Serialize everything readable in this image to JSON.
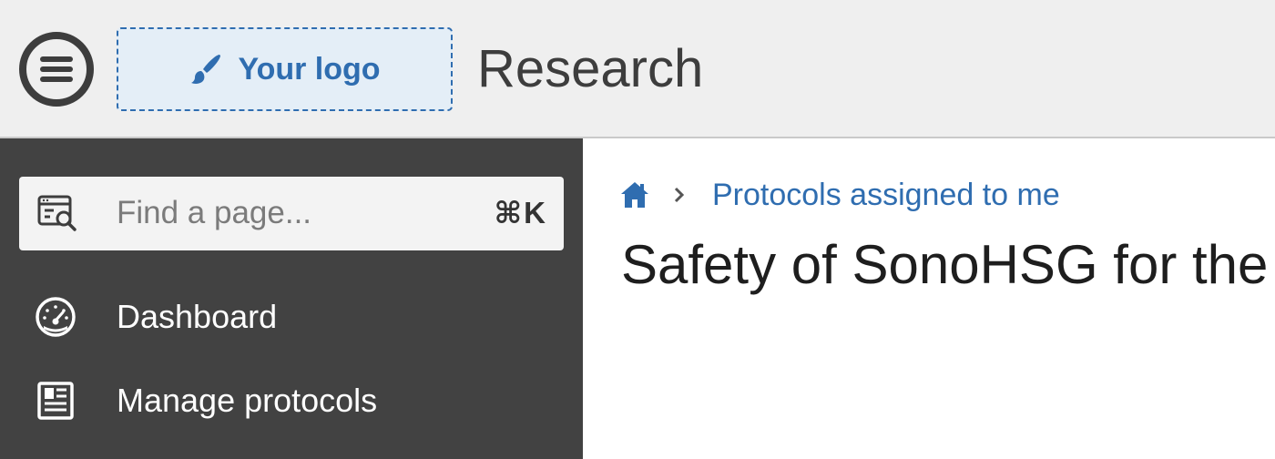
{
  "header": {
    "menu_icon": "hamburger-menu-icon",
    "logo": {
      "icon": "paintbrush-icon",
      "label": "Your logo"
    },
    "app_title": "Research"
  },
  "sidebar": {
    "search": {
      "icon": "page-search-icon",
      "placeholder": "Find a page...",
      "shortcut": "⌘K"
    },
    "items": [
      {
        "icon": "dashboard-gauge-icon",
        "label": "Dashboard"
      },
      {
        "icon": "protocol-document-icon",
        "label": "Manage protocols"
      }
    ]
  },
  "main": {
    "breadcrumb": {
      "home_icon": "home-icon",
      "separator_icon": "chevron-right-icon",
      "items": [
        {
          "label": "Protocols assigned to me"
        }
      ]
    },
    "page_title": "Safety of SonoHSG for the"
  },
  "colors": {
    "header_bg": "#efefef",
    "sidebar_bg": "#424242",
    "accent": "#2f6db0",
    "logo_bg": "#e4eef7"
  }
}
